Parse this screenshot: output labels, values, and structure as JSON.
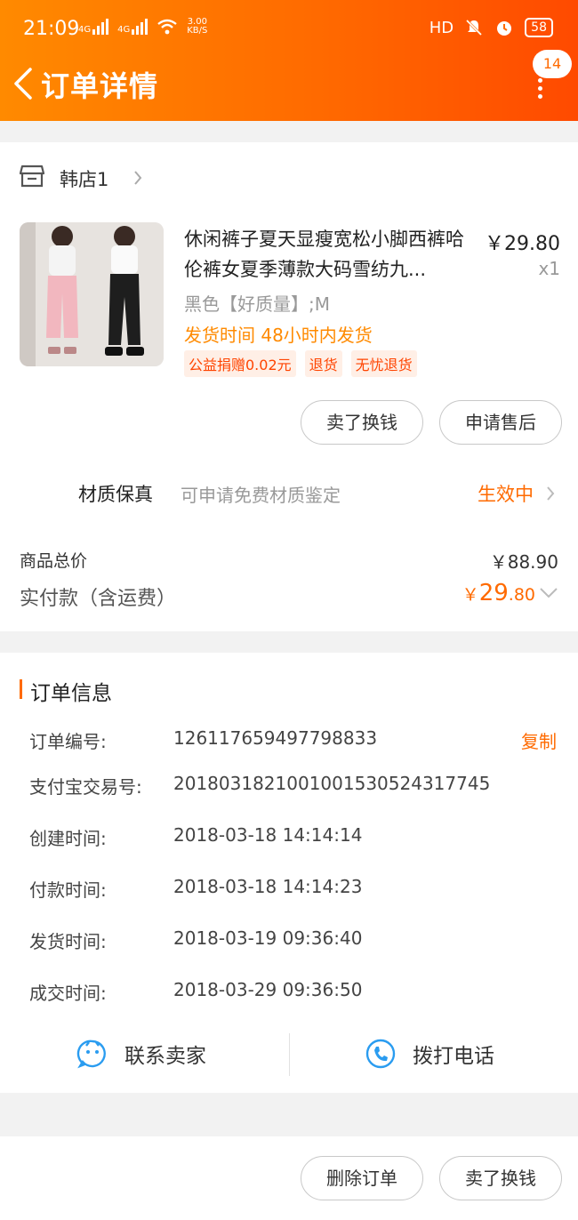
{
  "status_bar": {
    "time": "21:09",
    "net1": "4G",
    "net2": "4G",
    "speed_top": "3.00",
    "speed_bottom": "KB/S",
    "hd": "HD",
    "battery": "58"
  },
  "header": {
    "title": "订单详情",
    "badge": "14",
    "bg_from": "#ff8a00",
    "bg_to": "#ff4a00"
  },
  "store": {
    "name": "韩店1"
  },
  "product": {
    "title": "休闲裤子夏天显瘦宽松小脚西裤哈伦裤女夏季薄款大码雪纺九...",
    "price": "￥29.80",
    "qty": "x1",
    "sku": "黑色【好质量】;M",
    "ship": "发货时间 48小时内发货",
    "tags": [
      "公益捐赠0.02元",
      "退货",
      "无忧退货"
    ]
  },
  "item_buttons": {
    "sell": "卖了换钱",
    "after_sale": "申请售后"
  },
  "material": {
    "label": "材质保真",
    "desc": "可申请免费材质鉴定",
    "status": "生效中"
  },
  "totals": {
    "total_label": "商品总价",
    "total_value": "￥88.90",
    "paid_label": "实付款（含运费）",
    "paid_currency": "￥",
    "paid_int": "29",
    "paid_dec": ".80"
  },
  "order_info": {
    "title": "订单信息",
    "copy": "复制",
    "rows": [
      {
        "k": "订单编号:",
        "v": "126117659497798833"
      },
      {
        "k": "支付宝交易号:",
        "v": "2018031821001001530524317745"
      },
      {
        "k": "创建时间:",
        "v": "2018-03-18 14:14:14"
      },
      {
        "k": "付款时间:",
        "v": "2018-03-18 14:14:23"
      },
      {
        "k": "发货时间:",
        "v": "2018-03-19 09:36:40"
      },
      {
        "k": "成交时间:",
        "v": "2018-03-29 09:36:50"
      }
    ]
  },
  "contact": {
    "seller": "联系卖家",
    "phone": "拨打电话"
  },
  "footer": {
    "delete": "删除订单",
    "sell": "卖了换钱"
  },
  "colors": {
    "accent": "#ff6a00",
    "icon_blue": "#2a9cf0",
    "tag_bg": "#ffefe6"
  }
}
